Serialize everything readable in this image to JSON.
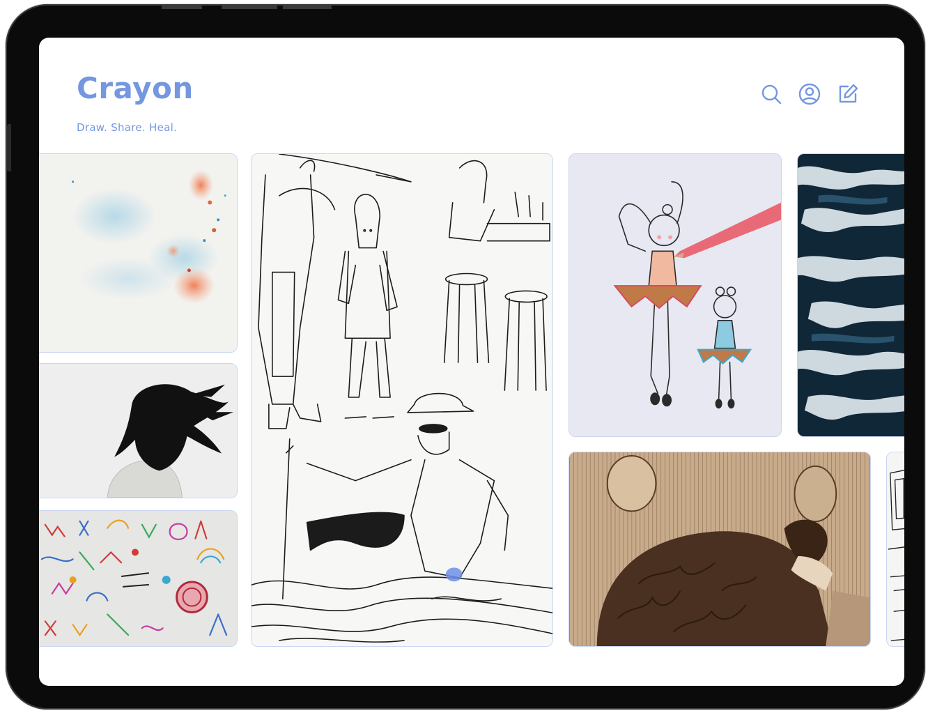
{
  "app": {
    "title": "Crayon",
    "tagline": "Draw. Share. Heal."
  },
  "header": {
    "icons": [
      {
        "name": "search-icon"
      },
      {
        "name": "user-profile-icon"
      },
      {
        "name": "compose-icon"
      }
    ]
  },
  "colors": {
    "brand": "#7497e0",
    "card_border": "#c9d5f2",
    "device_frame": "#0b0b0c"
  },
  "gallery": {
    "items": [
      {
        "name": "watercolor-splash"
      },
      {
        "name": "ink-line-drawing-beach"
      },
      {
        "name": "ballerina-pencil-drawing"
      },
      {
        "name": "ocean-waves-photo"
      },
      {
        "name": "woman-flowing-hair-photo"
      },
      {
        "name": "colorful-doodle-pattern"
      },
      {
        "name": "sepia-etching-sleeping-woman"
      },
      {
        "name": "sketch-partial"
      }
    ]
  }
}
